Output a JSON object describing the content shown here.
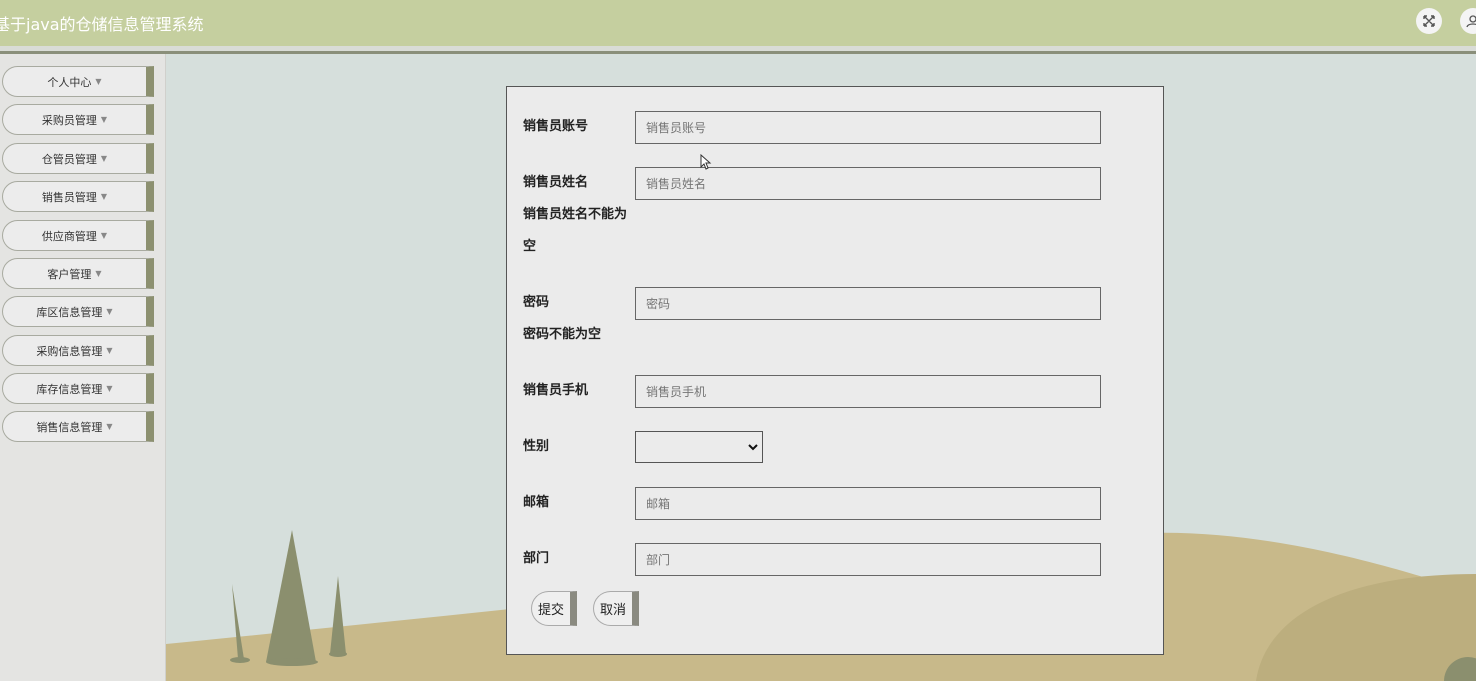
{
  "header": {
    "title": "基于java的仓储信息管理系统",
    "fullscreen_icon": "fullscreen-icon",
    "user_icon": "user-icon"
  },
  "sidebar": {
    "items": [
      {
        "label": "个人中心"
      },
      {
        "label": "采购员管理"
      },
      {
        "label": "仓管员管理"
      },
      {
        "label": "销售员管理"
      },
      {
        "label": "供应商管理"
      },
      {
        "label": "客户管理"
      },
      {
        "label": "库区信息管理"
      },
      {
        "label": "采购信息管理"
      },
      {
        "label": "库存信息管理"
      },
      {
        "label": "销售信息管理"
      }
    ]
  },
  "form": {
    "account": {
      "label": "销售员账号",
      "placeholder": "销售员账号",
      "value": ""
    },
    "name": {
      "label": "销售员姓名",
      "placeholder": "销售员姓名",
      "value": "",
      "error_line1": "销售员姓名不能为",
      "error_line2": "空"
    },
    "password": {
      "label": "密码",
      "placeholder": "密码",
      "value": "",
      "error": "密码不能为空"
    },
    "phone": {
      "label": "销售员手机",
      "placeholder": "销售员手机",
      "value": ""
    },
    "gender": {
      "label": "性别",
      "selected": ""
    },
    "email": {
      "label": "邮箱",
      "placeholder": "邮箱",
      "value": ""
    },
    "department": {
      "label": "部门",
      "placeholder": "部门",
      "value": ""
    },
    "submit_label": "提交",
    "cancel_label": "取消"
  }
}
